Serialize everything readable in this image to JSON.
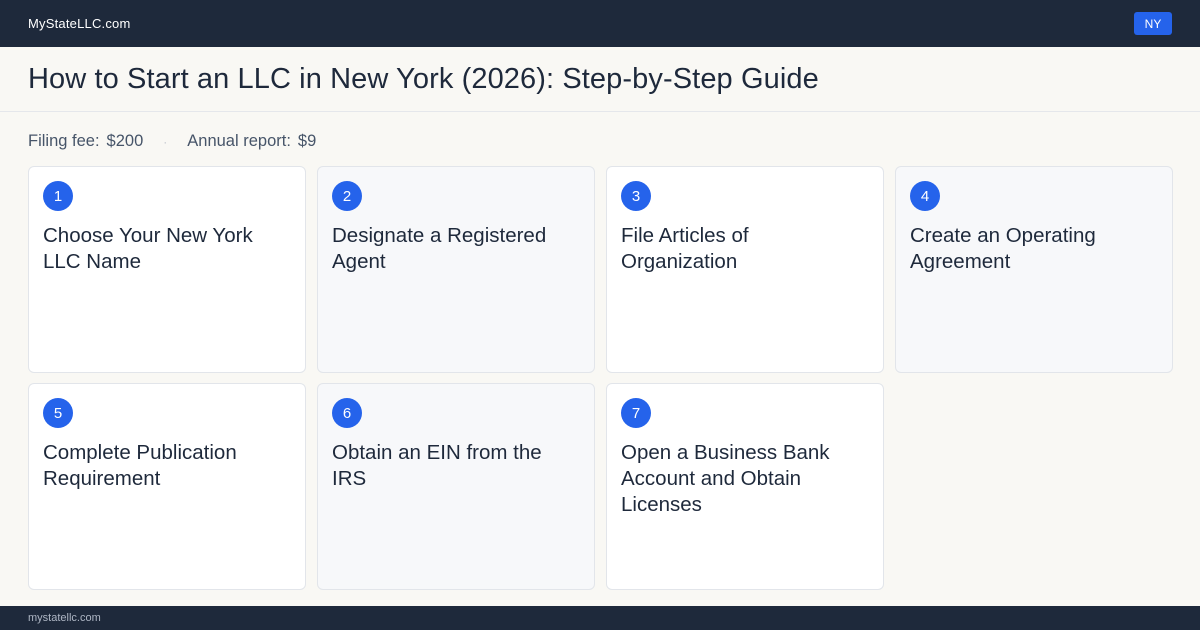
{
  "header": {
    "brand": "MyStateLLC.com",
    "state_badge": "NY"
  },
  "page": {
    "title": "How to Start an LLC in New York (2026): Step-by-Step Guide"
  },
  "facts": {
    "filing_fee_label": "Filing fee:",
    "filing_fee_value": "$200",
    "separator": "·",
    "annual_report_label": "Annual report:",
    "annual_report_value": "$9"
  },
  "steps": [
    {
      "number": "1",
      "title": "Choose Your New York LLC Name"
    },
    {
      "number": "2",
      "title": "Designate a Registered Agent"
    },
    {
      "number": "3",
      "title": "File Articles of Organization"
    },
    {
      "number": "4",
      "title": "Create an Operating Agreement"
    },
    {
      "number": "5",
      "title": "Complete Publication Requirement"
    },
    {
      "number": "6",
      "title": "Obtain an EIN from the IRS"
    },
    {
      "number": "7",
      "title": "Open a Business Bank Account and Obtain Licenses"
    }
  ],
  "footer": {
    "domain": "mystatellc.com"
  },
  "colors": {
    "navy": "#1e293b",
    "accent": "#2563eb",
    "background": "#f9f8f4"
  }
}
